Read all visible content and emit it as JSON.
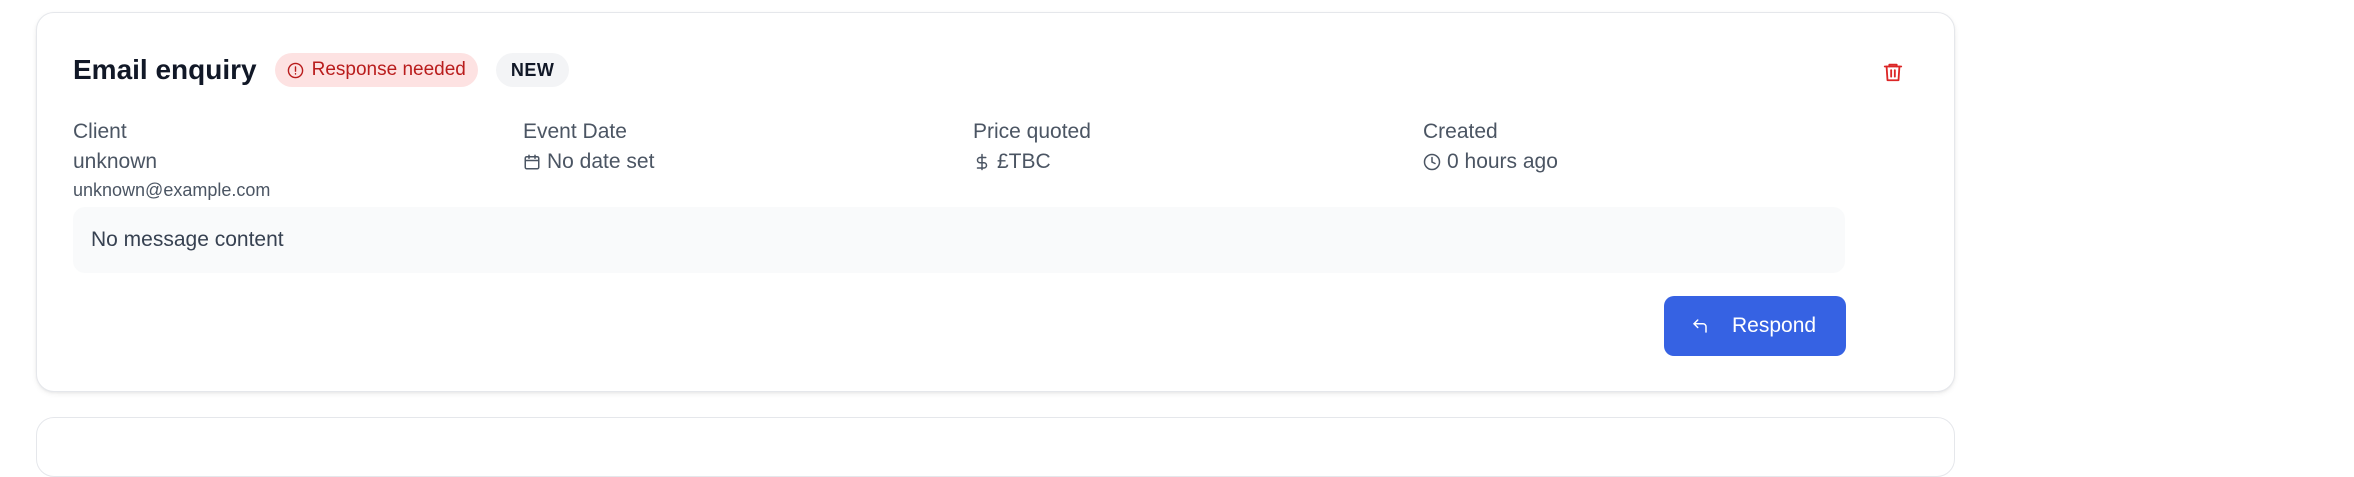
{
  "enquiry": {
    "title": "Email enquiry",
    "status_badge": "Response needed",
    "new_badge": "NEW",
    "client": {
      "label": "Client",
      "name": "unknown",
      "email": "unknown@example.com"
    },
    "event_date": {
      "label": "Event Date",
      "value": "No date set"
    },
    "price": {
      "label": "Price quoted",
      "value": "£TBC"
    },
    "created": {
      "label": "Created",
      "value": "0 hours ago"
    },
    "message": "No message content",
    "respond_label": "Respond"
  },
  "colors": {
    "accent": "#3662e3",
    "danger": "#dc2626",
    "danger_bg": "#fde2e2"
  },
  "icons": {
    "status": "alert-circle-icon",
    "delete": "trash-icon",
    "date": "calendar-icon",
    "price": "dollar-icon",
    "created": "clock-icon",
    "respond": "reply-icon"
  }
}
